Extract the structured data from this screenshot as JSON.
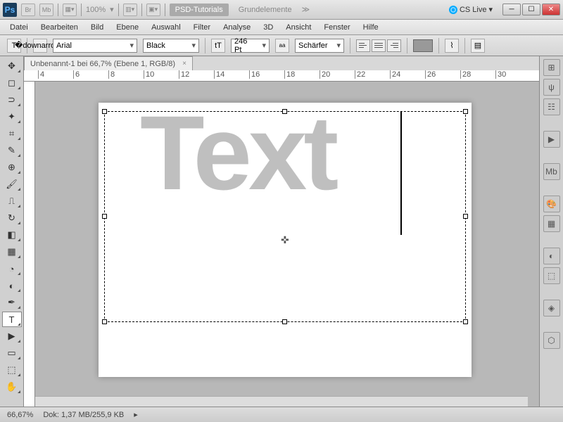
{
  "titlebar": {
    "zoom": "100%",
    "label1": "PSD-Tutorials",
    "label2": "Grundelemente",
    "cslive": "CS Live"
  },
  "menu": [
    "Datei",
    "Bearbeiten",
    "Bild",
    "Ebene",
    "Auswahl",
    "Filter",
    "Analyse",
    "3D",
    "Ansicht",
    "Fenster",
    "Hilfe"
  ],
  "options": {
    "font": "Arial",
    "style": "Black",
    "size": "246 Pt",
    "aa": "Schärfer"
  },
  "doc": {
    "tab": "Unbenannt-1 bei 66,7% (Ebene 1, RGB/8)",
    "ruler_marks": [
      "4",
      "6",
      "8",
      "10",
      "12",
      "14",
      "16",
      "18",
      "20",
      "22",
      "24",
      "26",
      "28",
      "30"
    ],
    "text": "Text"
  },
  "status": {
    "zoom": "66,67%",
    "dok": "Dok: 1,37 MB/255,9 KB"
  }
}
